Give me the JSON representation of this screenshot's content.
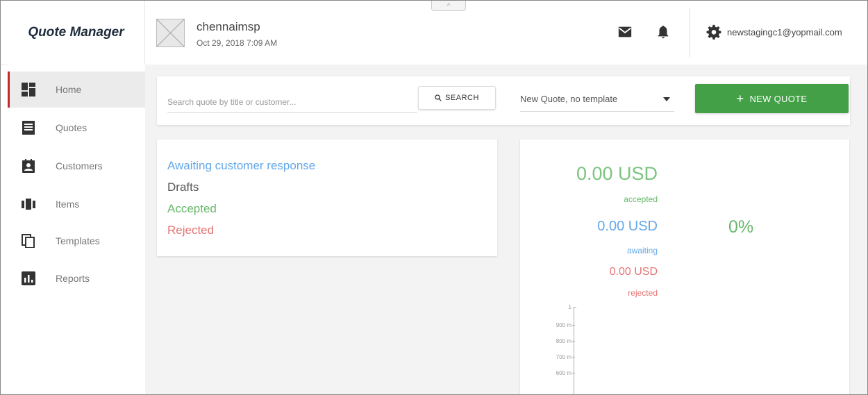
{
  "header": {
    "brand": "Quote Manager",
    "org_name": "chennaimsp",
    "org_date": "Oct 29, 2018 7:09 AM",
    "collapse_glyph": "^",
    "mail_icon": "mail-icon",
    "bell_icon": "bell-icon",
    "gear_icon": "gear-icon",
    "user_email": "newstagingc1@yopmail.com"
  },
  "sidebar": {
    "items": [
      {
        "label": "Home",
        "icon": "dashboard-icon",
        "active": true
      },
      {
        "label": "Quotes",
        "icon": "document-icon",
        "active": false
      },
      {
        "label": "Customers",
        "icon": "contact-icon",
        "active": false
      },
      {
        "label": "Items",
        "icon": "items-icon",
        "active": false
      },
      {
        "label": "Templates",
        "icon": "copy-icon",
        "active": false
      },
      {
        "label": "Reports",
        "icon": "chart-icon",
        "active": false
      }
    ]
  },
  "search": {
    "placeholder": "Search quote by title or customer...",
    "button_label": "SEARCH"
  },
  "template_select": {
    "selected": "New Quote, no template"
  },
  "new_quote_button": {
    "label": "NEW QUOTE"
  },
  "status_links": {
    "awaiting": "Awaiting customer response",
    "drafts": "Drafts",
    "accepted": "Accepted",
    "rejected": "Rejected"
  },
  "stats": {
    "accepted_value": "0.00 USD",
    "accepted_label": "accepted",
    "awaiting_value": "0.00 USD",
    "awaiting_label": "awaiting",
    "rejected_value": "0.00 USD",
    "rejected_label": "rejected",
    "percent": "0%"
  },
  "mini_chart": {
    "ticks": [
      "1",
      "900 m",
      "800 m",
      "700 m",
      "600 m"
    ]
  },
  "colors": {
    "accent_green": "#43a047",
    "awaiting_blue": "#64a8e8",
    "accepted_green": "#6ab86d",
    "rejected_red": "#e57373",
    "active_marker": "#c62828"
  }
}
